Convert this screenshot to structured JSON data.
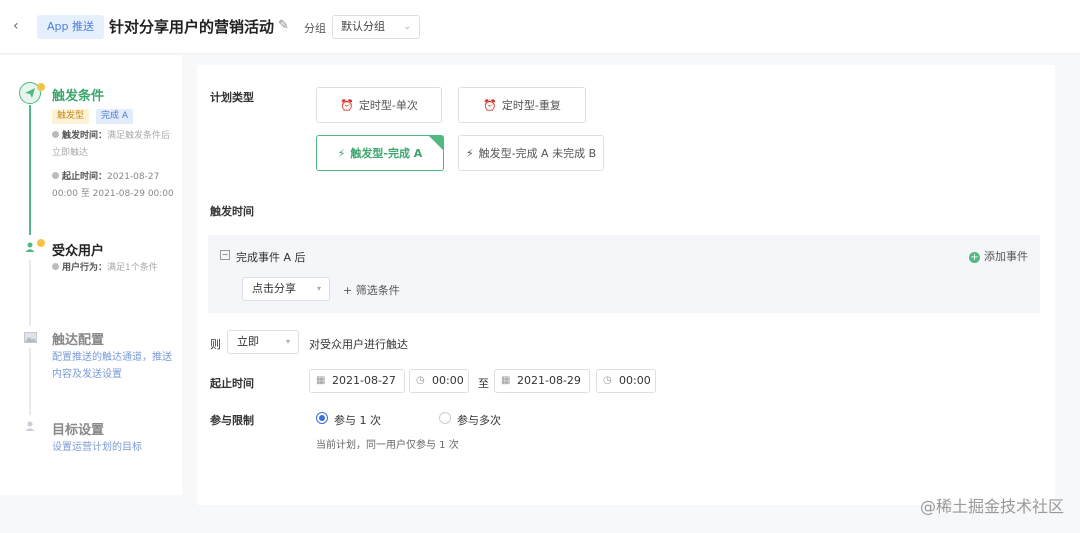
{
  "header": {
    "back_icon": "chevron-left-icon",
    "app_tag": "App 推送",
    "title": "针对分享用户的营销活动",
    "edit_icon": "pencil-icon",
    "group_label": "分组",
    "group_value": "默认分组"
  },
  "sidebar": {
    "steps": [
      {
        "title": "触发条件",
        "icon": "paper-plane-icon",
        "state": "active",
        "badges": [
          "触发型",
          "完成 A"
        ],
        "trigger_time_label": "触发时间：",
        "trigger_time_value": "满足触发条件后",
        "trigger_time_value2": "立即触达",
        "range_label": "起止时间：",
        "range_value": "2021-08-27",
        "range_value2": "00:00 至 2021-08-29 00:00"
      },
      {
        "title": "受众用户",
        "icon": "user-icon",
        "state": "done",
        "behavior_label": "用户行为：",
        "behavior_value": "满足1个条件"
      },
      {
        "title": "触达配置",
        "icon": "image-icon",
        "state": "pending",
        "desc": "配置推送的触达通道，推送内容及发送设置"
      },
      {
        "title": "目标设置",
        "icon": "user-icon",
        "state": "pending",
        "desc": "设置运营计划的目标"
      }
    ]
  },
  "main": {
    "plan_type_label": "计划类型",
    "plan_types": [
      {
        "label": "定时型-单次",
        "icon": "alarm-clock-icon",
        "active": false
      },
      {
        "label": "定时型-重复",
        "icon": "alarm-clock-icon",
        "active": false
      },
      {
        "label": "触发型-完成 A",
        "icon": "lightning-icon",
        "active": true
      },
      {
        "label": "触发型-完成 A 未完成 B",
        "icon": "lightning-icon",
        "active": false
      }
    ],
    "trigger_time_label": "触发时间",
    "event_title": "完成事件 A 后",
    "add_event": "添加事件",
    "event_select": "点击分享",
    "filter_link": "+ 筛选条件",
    "then_label": "则",
    "then_select": "立即",
    "then_suffix": "对受众用户进行触达",
    "range_label": "起止时间",
    "start_date": "2021-08-27",
    "start_time": "00:00",
    "to_label": "至",
    "end_date": "2021-08-29",
    "end_time": "00:00",
    "limit_label": "参与限制",
    "limit_options": [
      {
        "label": "参与 1 次",
        "selected": true
      },
      {
        "label": "参与多次",
        "selected": false
      }
    ],
    "limit_hint": "当前计划，同一用户仅参与 1 次"
  },
  "watermark": "@稀土掘金技术社区",
  "colors": {
    "accent_green": "#52b882",
    "accent_blue": "#3a6fd8",
    "badge_yellow_bg": "#fdf1d6",
    "badge_blue_bg": "#e3ecfb"
  }
}
